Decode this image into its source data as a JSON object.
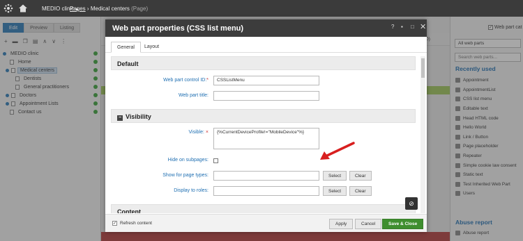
{
  "topbar": {
    "site": "MEDIO clinic",
    "caret": "▴",
    "crumb_pages": "Pages",
    "crumb_sep": "›",
    "crumb_current": "Medical centers",
    "crumb_type": "(Page)"
  },
  "left": {
    "tabs": [
      "Edit",
      "Preview",
      "Listing"
    ],
    "tree": [
      {
        "label": "MEDIO clinic",
        "level": 0
      },
      {
        "label": "Home",
        "level": 1
      },
      {
        "label": "Medical centers",
        "level": 1,
        "selected": true
      },
      {
        "label": "Dentists",
        "level": 2
      },
      {
        "label": "General practitioners",
        "level": 2
      },
      {
        "label": "Doctors",
        "level": 1
      },
      {
        "label": "Appointment Lists",
        "level": 1
      },
      {
        "label": "Contact us",
        "level": 1
      }
    ]
  },
  "right": {
    "checkbox_label": "Web part cat",
    "select_value": "All web parts",
    "search_placeholder": "Search web parts...",
    "recently_used_title": "Recently used",
    "items": [
      "Appointment",
      "AppointmentList",
      "CSS list menu",
      "Editable text",
      "Head HTML code",
      "Hello World",
      "Link / Button",
      "Page placeholder",
      "Repeater",
      "Simple cookie law consent",
      "Static text",
      "Test Inherited Web Part",
      "Users"
    ],
    "abuse_title": "Abuse report",
    "abuse_item": "Abuse report",
    "mid_value": "(0)"
  },
  "modal": {
    "title": "Web part properties (CSS list menu)",
    "ctrl_help": "?",
    "ctrl_min": "▪",
    "ctrl_max": "□",
    "ctrl_close": "✕",
    "tabs": [
      "General",
      "Layout"
    ],
    "sections": {
      "default": "Default",
      "visibility": "Visibility",
      "content": "Content"
    },
    "fields": {
      "control_id_label": "Web part control ID:",
      "control_id_value": "CSSListMenu",
      "title_label": "Web part title:",
      "title_value": "",
      "visible_label": "Visible:",
      "visible_value": "{%CurrentDeviceProfile!=\"MobileDevice\"%}",
      "hide_label": "Hide on subpages:",
      "show_label": "Show for page types:",
      "roles_label": "Display to roles:"
    },
    "buttons": {
      "select": "Select",
      "clear": "Clear"
    },
    "footer": {
      "refresh_label": "Refresh content",
      "apply": "Apply",
      "cancel": "Cancel",
      "save_close": "Save & Close"
    }
  }
}
